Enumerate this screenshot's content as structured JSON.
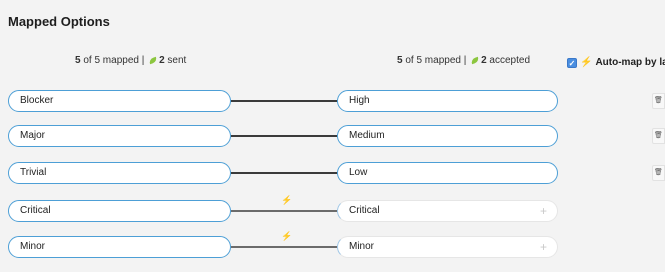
{
  "title": "Mapped Options",
  "summary_left": {
    "count": "5",
    "mapped_text": " of 5 mapped | ",
    "sent_count": "2",
    "sent_text": " sent"
  },
  "summary_right": {
    "count": "5",
    "mapped_text": " of 5 mapped | ",
    "accepted_count": "2",
    "accepted_text": " accepted"
  },
  "automap": {
    "label": "Auto-map by label",
    "checked": true
  },
  "rows": [
    {
      "left": "Blocker",
      "right": "High"
    },
    {
      "left": "Major",
      "right": "Medium"
    },
    {
      "left": "Trivial",
      "right": "Low"
    },
    {
      "left": "Critical",
      "right": "Critical"
    },
    {
      "left": "Minor",
      "right": "Minor"
    }
  ],
  "icons": {
    "trash": "trash-icon",
    "wand": "magic-wand-icon",
    "plus": "plus-icon",
    "leaf": "leaf-icon"
  }
}
